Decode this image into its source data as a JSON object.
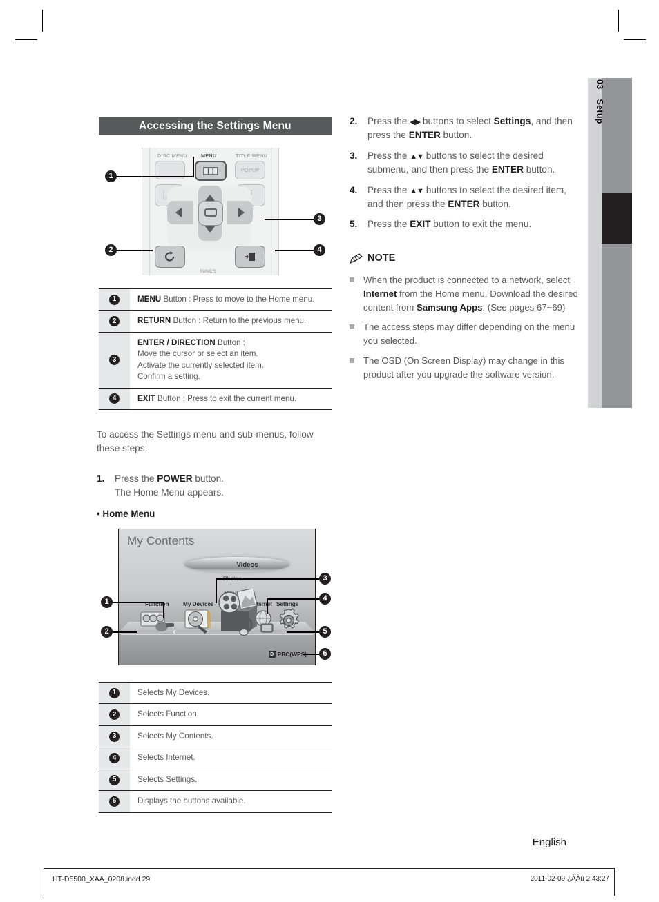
{
  "page": {
    "side_tab": {
      "number": "03",
      "label": "Setup"
    },
    "language": "English",
    "footer_left": "HT-D5500_XAA_0208.indd   29",
    "footer_right": "2011-02-09   ¿ÀÀü 2:43:27"
  },
  "section": {
    "title": "Accessing the Settings Menu"
  },
  "remote": {
    "labels": {
      "disc_menu": "DISC MENU",
      "menu": "MENU",
      "title_menu": "TITLE MENU",
      "popup": "POPUP",
      "info": "i",
      "tuner": "TUNER"
    },
    "callouts": [
      "1",
      "2",
      "3",
      "4"
    ]
  },
  "remote_table": {
    "rows": [
      {
        "num": "1",
        "bold": "MENU",
        "rest": " Button : Press to move to the Home menu.",
        "lines": []
      },
      {
        "num": "2",
        "bold": "RETURN",
        "rest": " Button : Return to the previous menu.",
        "lines": []
      },
      {
        "num": "3",
        "bold": "ENTER / DIRECTION",
        "rest": " Button :",
        "lines": [
          "Move the cursor or select an item.",
          "Activate the currently selected item.",
          "Confirm a setting."
        ]
      },
      {
        "num": "4",
        "bold": "EXIT",
        "rest": " Button : Press to exit the current menu.",
        "lines": []
      }
    ]
  },
  "intro": {
    "paragraph": "To access the Settings menu and sub-menus, follow these steps:",
    "step1_num": "1.",
    "step1_line1_pre": "Press the ",
    "step1_line1_bold": "POWER",
    "step1_line1_post": " button.",
    "step1_line2": "The Home Menu appears.",
    "bullet_home_menu": "• Home Menu"
  },
  "home_menu": {
    "title": "My Contents",
    "carousel": {
      "selected": "Videos",
      "below1": "Photos",
      "below2": "Music"
    },
    "icons": [
      "Function",
      "My Devices",
      "Internet",
      "Settings"
    ],
    "pbc_badge": "D",
    "pbc_label": "PBC(WPS)",
    "callouts": [
      "1",
      "2",
      "3",
      "4",
      "5",
      "6"
    ]
  },
  "home_table": {
    "rows": [
      {
        "num": "1",
        "text": "Selects My Devices."
      },
      {
        "num": "2",
        "text": "Selects Function."
      },
      {
        "num": "3",
        "text": "Selects My Contents."
      },
      {
        "num": "4",
        "text": "Selects Internet."
      },
      {
        "num": "5",
        "text": "Selects Settings."
      },
      {
        "num": "6",
        "text": "Displays the buttons available."
      }
    ]
  },
  "right_steps": [
    {
      "num": "2.",
      "parts": [
        {
          "t": "Press the ",
          "b": false
        },
        {
          "t": "◀▶",
          "b": false,
          "arrow": true
        },
        {
          "t": " buttons to select ",
          "b": false
        },
        {
          "t": "Settings",
          "b": true
        },
        {
          "t": ", and then press the ",
          "b": false
        },
        {
          "t": "ENTER",
          "b": true
        },
        {
          "t": " button.",
          "b": false
        }
      ]
    },
    {
      "num": "3.",
      "parts": [
        {
          "t": "Press the ",
          "b": false
        },
        {
          "t": "▲▼",
          "b": false,
          "arrow": true
        },
        {
          "t": " buttons to select the desired submenu, and then press the ",
          "b": false
        },
        {
          "t": "ENTER",
          "b": true
        },
        {
          "t": " button.",
          "b": false
        }
      ]
    },
    {
      "num": "4.",
      "parts": [
        {
          "t": "Press the ",
          "b": false
        },
        {
          "t": "▲▼",
          "b": false,
          "arrow": true
        },
        {
          "t": " buttons to select the desired item, and then press the ",
          "b": false
        },
        {
          "t": "ENTER",
          "b": true
        },
        {
          "t": " button.",
          "b": false
        }
      ]
    },
    {
      "num": "5.",
      "parts": [
        {
          "t": "Press the ",
          "b": false
        },
        {
          "t": "EXIT",
          "b": true
        },
        {
          "t": " button to exit the menu.",
          "b": false
        }
      ]
    }
  ],
  "note": {
    "heading": "NOTE",
    "items": [
      [
        {
          "t": "When the product is connected to a network, select ",
          "b": false
        },
        {
          "t": "Internet",
          "b": true
        },
        {
          "t": " from the Home menu. Download the desired content from ",
          "b": false
        },
        {
          "t": "Samsung Apps",
          "b": true
        },
        {
          "t": ". (See pages 67~69)",
          "b": false
        }
      ],
      [
        {
          "t": "The access steps may differ depending on the menu you selected.",
          "b": false
        }
      ],
      [
        {
          "t": "The OSD (On Screen Display) may change in this product after you upgrade the software version.",
          "b": false
        }
      ]
    ]
  }
}
